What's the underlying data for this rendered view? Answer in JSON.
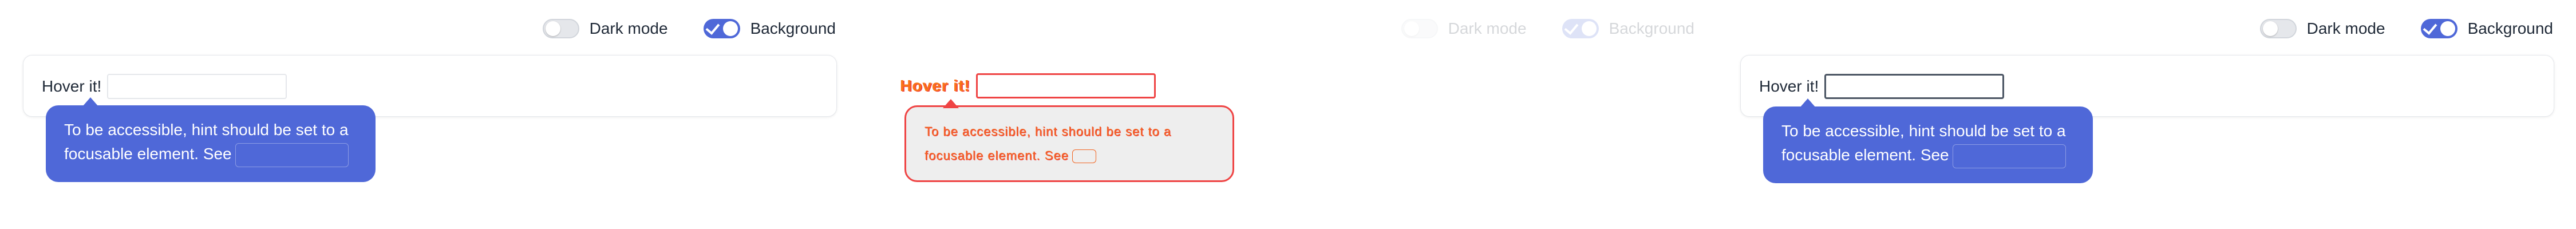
{
  "controls": {
    "dark_mode_label": "Dark mode",
    "dark_mode_on": false,
    "background_label": "Background",
    "background_on": true
  },
  "demo": {
    "hover_label": "Hover it!",
    "input_value": "",
    "tooltip_text": "To be accessible, hint should be set to a focusable element. See"
  },
  "colors": {
    "accent": "#4f68d8",
    "tooltip_text": "#ffffff",
    "glitch_orange": "#f97316",
    "glitch_red": "#ef4444"
  }
}
